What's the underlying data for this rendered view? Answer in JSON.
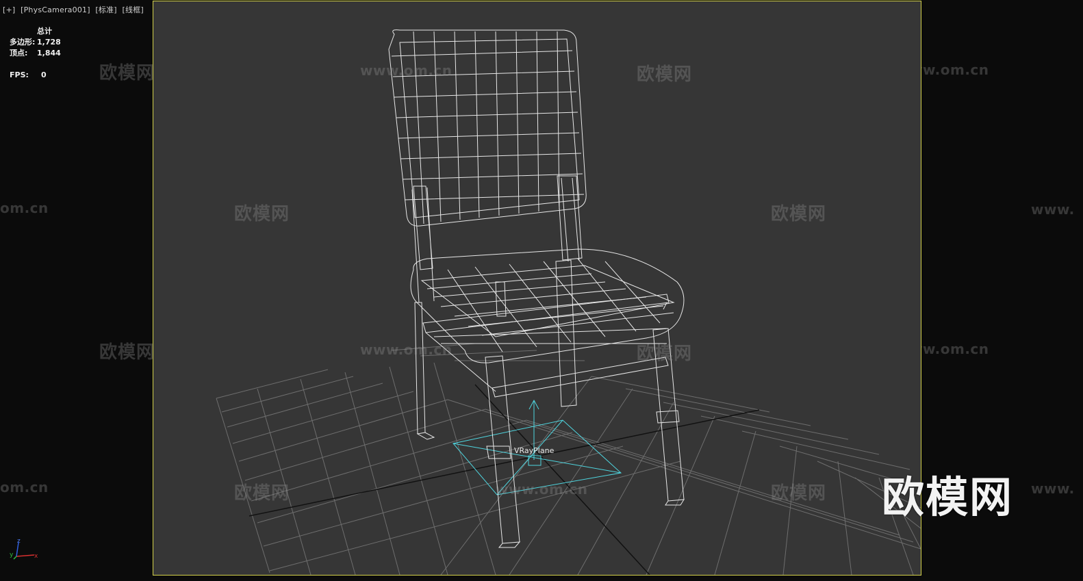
{
  "viewport": {
    "labels": [
      "[+]",
      "[PhysCamera001]",
      "[标准]",
      "[线框]"
    ]
  },
  "stats": {
    "header": "总计",
    "polygons_label": "多边形:",
    "polygons_value": "1,728",
    "vertices_label": "顶点:",
    "vertices_value": "1,844",
    "fps_label": "FPS:",
    "fps_value": "0"
  },
  "scene": {
    "object_label": "VRayPlane",
    "frame_color": "#d4d24a",
    "wire_color": "#e8e8e8",
    "helper_color": "#4fd6e0"
  },
  "watermark": {
    "logo_text": "欧模网",
    "url_text": "www.om.cn",
    "url_fragment": "om.cn",
    "url_prefix": "www."
  },
  "gizmo": {
    "x": "x",
    "y": "y",
    "z": "z"
  }
}
